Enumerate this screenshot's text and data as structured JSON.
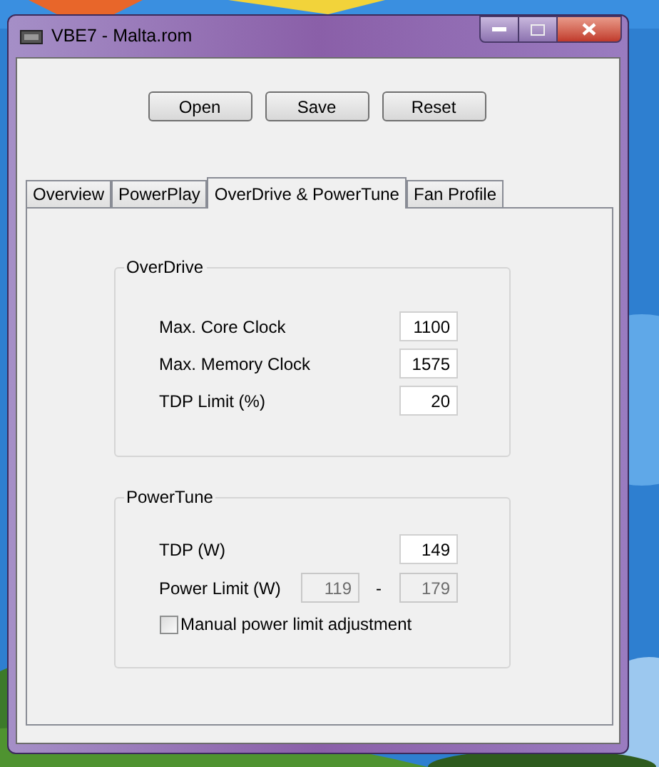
{
  "window": {
    "title": "VBE7 - Malta.rom"
  },
  "buttons": [
    "Open",
    "Save",
    "Reset"
  ],
  "tabs": [
    {
      "label": "Overview",
      "selected": false
    },
    {
      "label": "PowerPlay",
      "selected": false
    },
    {
      "label": "OverDrive & PowerTune",
      "selected": true
    },
    {
      "label": "Fan Profile",
      "selected": false
    }
  ],
  "overdrive": {
    "title": "OverDrive",
    "rows": [
      {
        "label": "Max. Core Clock",
        "value": "1100",
        "disabled": false
      },
      {
        "label": "Max. Memory Clock",
        "value": "1575",
        "disabled": false
      },
      {
        "label": "TDP Limit (%)",
        "value": "20",
        "disabled": false
      }
    ]
  },
  "powertune": {
    "title": "PowerTune",
    "tdp": {
      "label": "TDP (W)",
      "value": "149",
      "disabled": false
    },
    "power_limit": {
      "label": "Power Limit (W)",
      "min": {
        "value": "119",
        "disabled": true
      },
      "separator": "-",
      "max": {
        "value": "179",
        "disabled": true
      }
    },
    "manual_adjustment": {
      "label": "Manual power limit adjustment",
      "checked": false
    }
  }
}
